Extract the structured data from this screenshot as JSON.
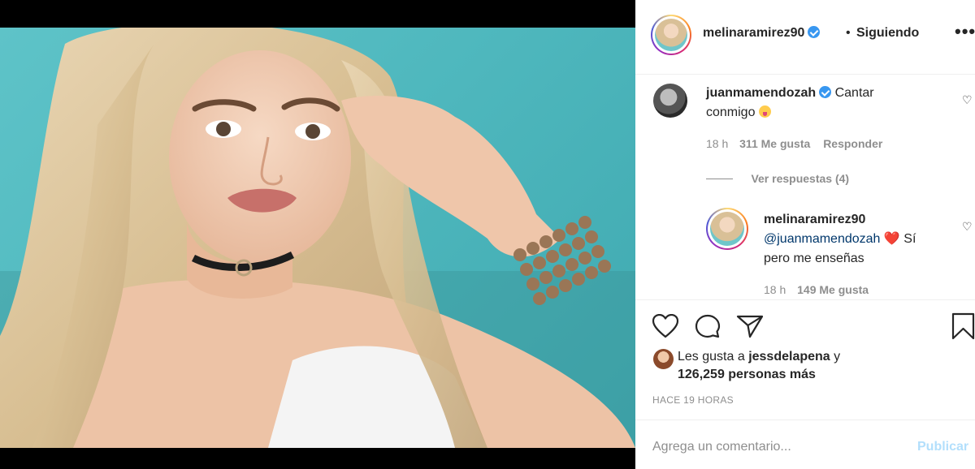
{
  "post": {
    "author": "melinaramirez90",
    "separator": "•",
    "follow_status": "Siguiendo",
    "more": "•••"
  },
  "comments": [
    {
      "username": "juanmamendozah",
      "text_line1": "Cantar",
      "text_line2": "conmigo",
      "emoji": "face-with-tongue-emoji",
      "time": "18 h",
      "likes": "311 Me gusta",
      "reply": "Responder",
      "view_replies": "Ver respuestas (4)"
    },
    {
      "username": "melinaramirez90",
      "mention": "@juanmamendozah",
      "heart": "❤️",
      "text_after_heart": "Sí",
      "text_line2": "pero me enseñas",
      "time": "18 h",
      "likes": "149 Me gusta"
    }
  ],
  "likes": {
    "prefix": "Les gusta a",
    "user": "jessdelapena",
    "connector": "y",
    "count": "126,259 personas más"
  },
  "time_ago": "HACE 19 HORAS",
  "add_comment": {
    "placeholder": "Agrega un comentario...",
    "publish": "Publicar"
  },
  "colors": {
    "accent_blue": "#3897f0",
    "publish_disabled": "#b2dffc",
    "heart_red": "#ed4956",
    "photo_background": "#5ec3c8"
  }
}
